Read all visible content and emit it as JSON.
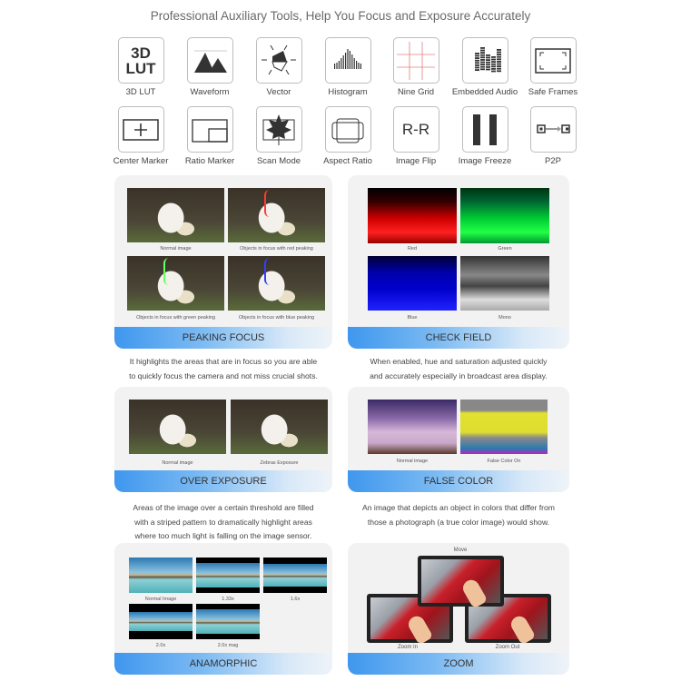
{
  "title": "Professional Auxiliary Tools, Help You Focus and Exposure Accurately",
  "tools": [
    {
      "label": "3D LUT",
      "icon": "3d-lut-icon",
      "text": "3D\nLUT"
    },
    {
      "label": "Waveform",
      "icon": "waveform-icon"
    },
    {
      "label": "Vector",
      "icon": "vector-icon"
    },
    {
      "label": "Histogram",
      "icon": "histogram-icon"
    },
    {
      "label": "Nine Grid",
      "icon": "nine-grid-icon"
    },
    {
      "label": "Embedded Audio",
      "icon": "audio-meter-icon"
    },
    {
      "label": "Safe Frames",
      "icon": "safe-frames-icon"
    },
    {
      "label": "Center Marker",
      "icon": "center-marker-icon"
    },
    {
      "label": "Ratio Marker",
      "icon": "ratio-marker-icon"
    },
    {
      "label": "Scan Mode",
      "icon": "maple-leaf-icon"
    },
    {
      "label": "Aspect Ratio",
      "icon": "aspect-ratio-icon"
    },
    {
      "label": "Image Flip",
      "icon": "image-flip-icon",
      "text": "R-R"
    },
    {
      "label": "Image Freeze",
      "icon": "pause-icon"
    },
    {
      "label": "P2P",
      "icon": "p2p-icon"
    }
  ],
  "panels": {
    "peaking": {
      "title": "PEAKING FOCUS",
      "captions": [
        "Normal image",
        "Objects in focus with red peaking",
        "Objects in focus with green peaking",
        "Objects in focus with blue peaking"
      ],
      "description": [
        "It highlights the areas that are in focus so you are able",
        "to quickly focus the camera and not miss crucial shots."
      ]
    },
    "check": {
      "title": "CHECK FIELD",
      "captions": [
        "Red",
        "Green",
        "Blue",
        "Mono"
      ],
      "description": [
        "When enabled,  hue and saturation adjusted quickly",
        "and accurately especially in broadcast area display."
      ]
    },
    "exposure": {
      "title": "OVER EXPOSURE",
      "captions": [
        "Normal image",
        "Zebras Exposure"
      ],
      "description": [
        "Areas of the image over a certain threshold are filled",
        "with a striped pattern to dramatically highlight areas",
        "where too much light is falling  on the image sensor."
      ]
    },
    "falsecolor": {
      "title": "FALSE COLOR",
      "captions": [
        "Normal image",
        "False Color On"
      ],
      "description": [
        "An image that depicts an object in colors that differ from",
        "those a photograph (a true color image) would show."
      ]
    },
    "anamorphic": {
      "title": "ANAMORPHIC",
      "captions": [
        "Normal Image",
        "1.33x",
        "1.6x",
        "2.0x",
        "2.0x mag"
      ]
    },
    "zoom": {
      "title": "ZOOM",
      "captions": [
        "Move",
        "Zoom In",
        "Zoom Out"
      ]
    }
  },
  "colors": {
    "banner_start": "#3f97ee",
    "banner_end": "#eef3f8",
    "peaking_red": "#ff3b2f",
    "peaking_green": "#66ff66",
    "peaking_blue": "#3040ff"
  }
}
